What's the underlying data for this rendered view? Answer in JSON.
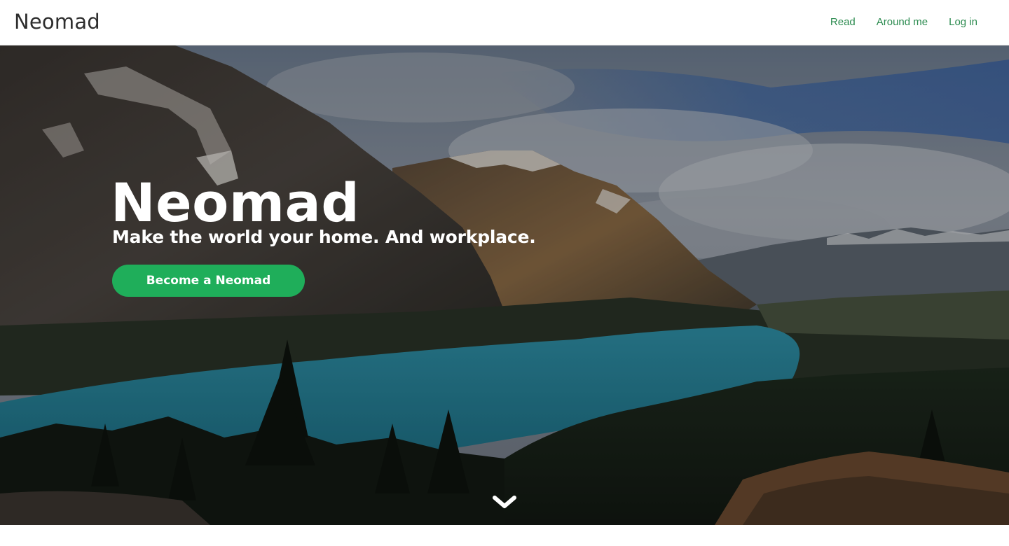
{
  "navbar": {
    "brand": "Neomad",
    "links": [
      {
        "label": "Read"
      },
      {
        "label": "Around me"
      },
      {
        "label": "Log in"
      }
    ]
  },
  "hero": {
    "title": "Neomad",
    "tagline": "Make the world your home. And workplace.",
    "cta_label": "Become a Neomad",
    "background": "mountain-lake-landscape",
    "scroll_icon": "chevron-down-icon"
  },
  "colors": {
    "accent": "#1fae5a",
    "nav_link": "#2a8a4e",
    "brand_text": "#2d2d2d"
  }
}
